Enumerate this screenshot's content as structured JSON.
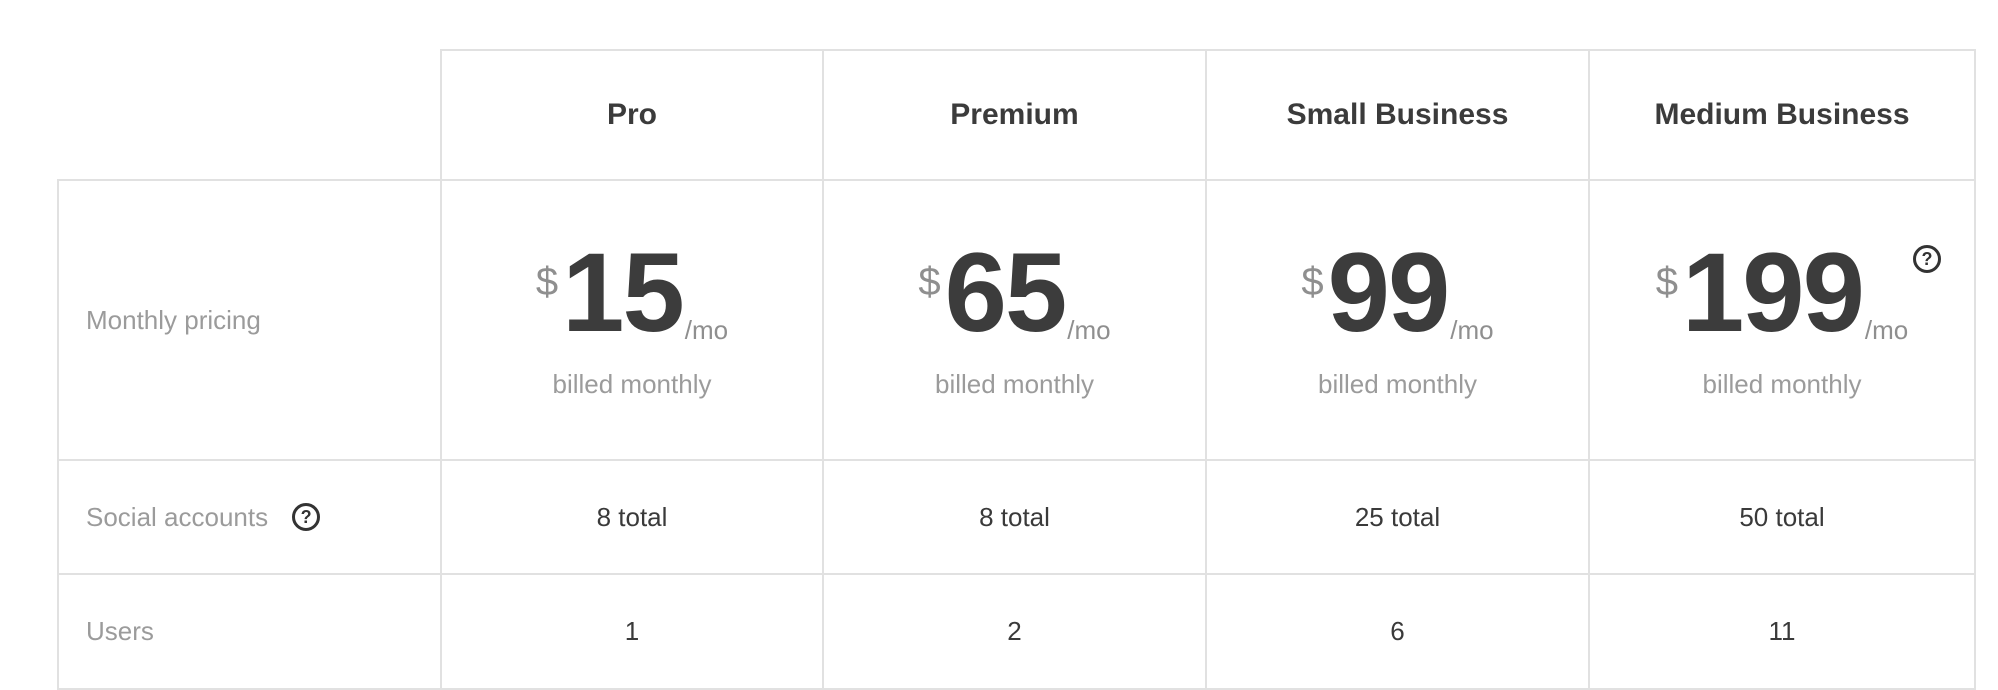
{
  "plans": [
    {
      "name": "Pro",
      "currency": "$",
      "price": "15",
      "per": "/mo",
      "billing": "billed monthly",
      "social_accounts": "8 total",
      "users": "1"
    },
    {
      "name": "Premium",
      "currency": "$",
      "price": "65",
      "per": "/mo",
      "billing": "billed monthly",
      "social_accounts": "8 total",
      "users": "2"
    },
    {
      "name": "Small Business",
      "currency": "$",
      "price": "99",
      "per": "/mo",
      "billing": "billed monthly",
      "social_accounts": "25 total",
      "users": "6"
    },
    {
      "name": "Medium Business",
      "currency": "$",
      "price": "199",
      "per": "/mo",
      "billing": "billed monthly",
      "social_accounts": "50 total",
      "users": "11"
    }
  ],
  "rows": {
    "pricing": "Monthly pricing",
    "social": "Social accounts",
    "users": "Users"
  },
  "icons": {
    "help": "?"
  },
  "colors": {
    "border": "#e1e1e1",
    "heading": "#3b3b3b",
    "muted": "#9b9b9b",
    "value": "#3a3a3a"
  }
}
